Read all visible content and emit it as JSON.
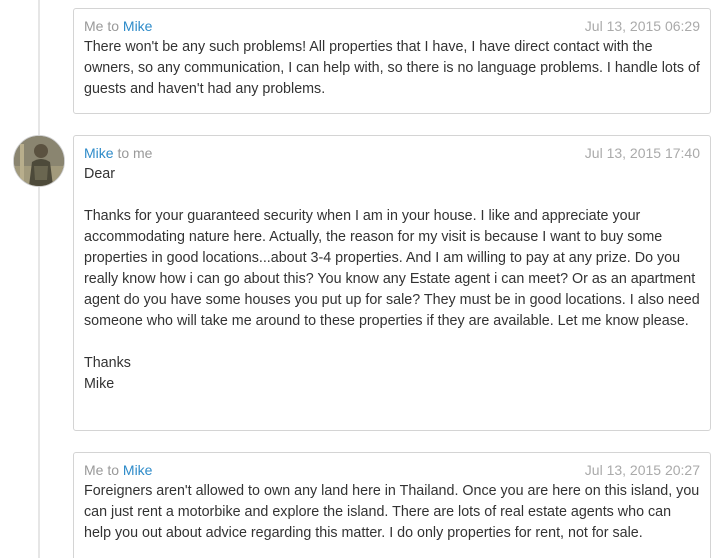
{
  "messages": [
    {
      "from_prefix": "Me to ",
      "from_name": "Mike",
      "date": "Jul 13, 2015 06:29",
      "paragraphs": [
        "There won't be any such problems! All properties that I have, I have direct contact with the owners, so any communication, I can help with, so there is no language problems. I handle lots of guests and haven't had any problems."
      ]
    },
    {
      "from_name": "Mike",
      "from_suffix": " to me",
      "date": "Jul 13, 2015 17:40",
      "paragraphs": [
        "Dear",
        "",
        "Thanks for your guaranteed security when I am in your house. I like and appreciate your accommodating nature here. Actually, the reason for my visit is because I want to buy some properties in good locations...about 3-4 properties. And I am willing to pay at any prize. Do you really know how i can go about this? You know any Estate agent i can meet? Or as an apartment agent do you have some houses you put up for sale? They must be in good locations. I also need someone who will take me around to these properties if they are available. Let me know please.",
        "",
        "Thanks",
        "Mike"
      ]
    },
    {
      "from_prefix": "Me to ",
      "from_name": "Mike",
      "date": "Jul 13, 2015 20:27",
      "paragraphs": [
        "Foreigners aren't allowed to own any land here in Thailand. Once you are here on this island, you can just rent a motorbike and explore the island. There are lots of real estate agents who can help you out about advice regarding this matter. I do only properties for rent, not for sale."
      ]
    }
  ],
  "colors": {
    "link": "#2e8bc9",
    "muted": "#999999",
    "border": "#d4d4d4"
  }
}
